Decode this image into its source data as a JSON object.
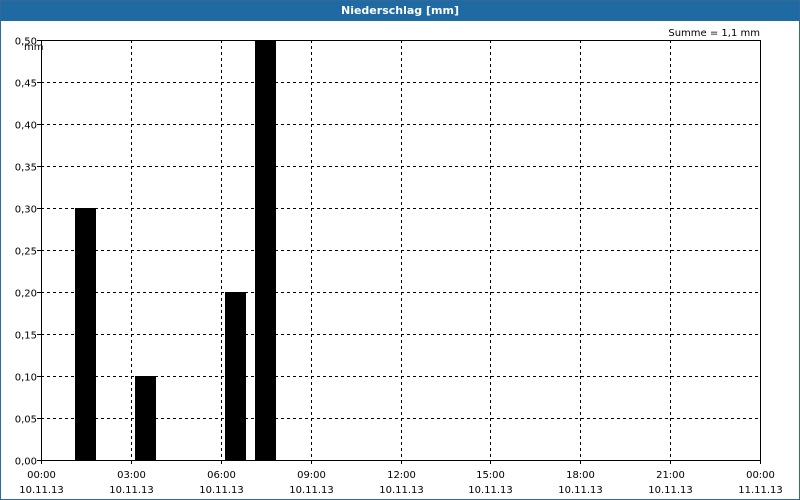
{
  "window": {
    "title": "Niederschlag [mm]"
  },
  "chart_data": {
    "type": "bar",
    "title": "Niederschlag [mm]",
    "ylabel": "mm",
    "summary": "Summe = 1,1 mm",
    "ylim": [
      0,
      0.5
    ],
    "xlim_hours": [
      0,
      24
    ],
    "y_ticks": [
      "0,00",
      "0,05",
      "0,10",
      "0,15",
      "0,20",
      "0,25",
      "0,30",
      "0,35",
      "0,40",
      "0,45",
      "0,50"
    ],
    "x_ticks": [
      {
        "time": "00:00",
        "date": "10.11.13"
      },
      {
        "time": "03:00",
        "date": "10.11.13"
      },
      {
        "time": "06:00",
        "date": "10.11.13"
      },
      {
        "time": "09:00",
        "date": "10.11.13"
      },
      {
        "time": "12:00",
        "date": "10.11.13"
      },
      {
        "time": "15:00",
        "date": "10.11.13"
      },
      {
        "time": "18:00",
        "date": "10.11.13"
      },
      {
        "time": "21:00",
        "date": "10.11.13"
      },
      {
        "time": "00:00",
        "date": "11.11.13"
      }
    ],
    "bars": [
      {
        "hour": 1.5,
        "value": 0.3
      },
      {
        "hour": 3.5,
        "value": 0.1
      },
      {
        "hour": 6.5,
        "value": 0.2
      },
      {
        "hour": 7.5,
        "value": 0.5
      }
    ],
    "grid": true,
    "bar_color": "#000000"
  }
}
